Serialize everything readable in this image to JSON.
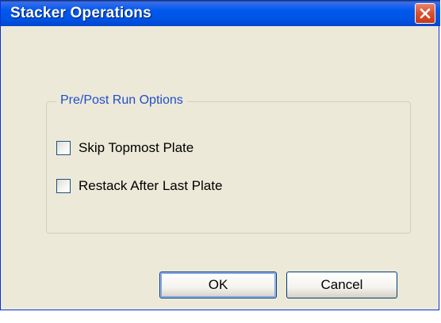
{
  "window": {
    "title": "Stacker Operations"
  },
  "group": {
    "label": "Pre/Post Run Options",
    "options": [
      {
        "label": "Skip Topmost Plate",
        "checked": false
      },
      {
        "label": "Restack After Last Plate",
        "checked": false
      }
    ]
  },
  "buttons": {
    "ok_label": "OK",
    "cancel_label": "Cancel"
  },
  "icons": {
    "close": "close-icon"
  },
  "colors": {
    "titlebar": "#0055e5",
    "close_button": "#d9502f",
    "dialog_background": "#ece9d8",
    "group_label": "#1f4fc8"
  }
}
